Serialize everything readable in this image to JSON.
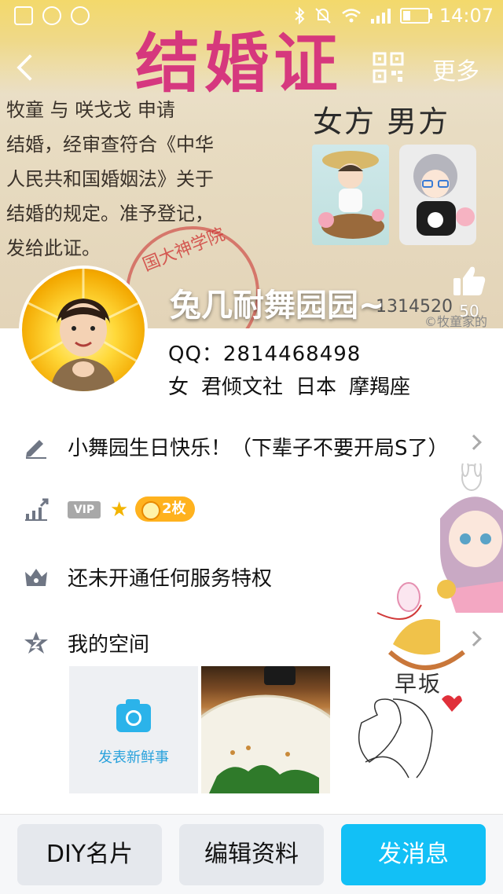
{
  "status_bar": {
    "time": "14:07",
    "battery_level": 0.3
  },
  "cover": {
    "cert_title": "结婚证",
    "cert_lines": [
      "牧童 与 咲戈戈 申请",
      "结婚，经审查符合《中华",
      "人民共和国婚姻法》关于",
      "结婚的规定。准予登记，",
      "发给此证。"
    ],
    "cert_labels": "女方 男方",
    "stamp_text": "国大神学院",
    "cert_number": "1314520",
    "watermark": "©牧童家的"
  },
  "header": {
    "more_label": "更多"
  },
  "profile": {
    "nickname": "兔几耐舞园园~",
    "like_count": "50",
    "qq_line": "QQ：2814468498",
    "tags": [
      "女",
      "君倾文社",
      "日本",
      "摩羯座"
    ]
  },
  "rows": {
    "signature": "小舞园生日快乐！（下辈子不要开局S了）",
    "vip_badge": "VIP",
    "coin_badge": "2枚",
    "service": "还未开通任何服务特权",
    "space": "我的空间"
  },
  "moments": {
    "new_post_label": "发表新鲜事"
  },
  "bottom_bar": {
    "diy_label": "DIY名片",
    "edit_label": "编辑资料",
    "message_label": "发消息"
  },
  "colors": {
    "accent": "#12c0f6",
    "coin": "#ffb21e",
    "star": "#f3b400"
  }
}
